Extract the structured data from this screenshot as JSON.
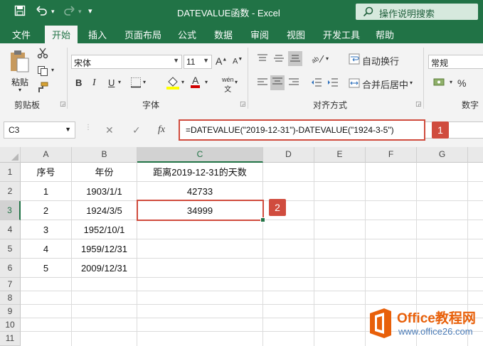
{
  "window": {
    "title": "DATEVALUE函数  -  Excel",
    "search_placeholder": "操作说明搜索"
  },
  "quick_access": {
    "save_icon": "save-icon",
    "undo_icon": "undo-icon",
    "redo_icon": "redo-icon",
    "more_icon": "▾"
  },
  "tabs": [
    "文件",
    "开始",
    "插入",
    "页面布局",
    "公式",
    "数据",
    "审阅",
    "视图",
    "开发工具",
    "帮助"
  ],
  "active_tab": "开始",
  "ribbon": {
    "clipboard": {
      "paste": "粘贴",
      "label": "剪贴板"
    },
    "font": {
      "name": "宋体",
      "size": "11",
      "bold": "B",
      "italic": "I",
      "underline": "U",
      "grow": "A",
      "shrink": "A",
      "font_color": "A",
      "phonetic": "wén",
      "label": "字体"
    },
    "alignment": {
      "wrap": "自动换行",
      "merge": "合并后居中",
      "label": "对齐方式"
    },
    "number": {
      "format": "常规",
      "percent": "%",
      "label": "数字"
    }
  },
  "formula_bar": {
    "name_box": "C3",
    "cancel": "✕",
    "enter": "✓",
    "fx": "fx",
    "formula": "=DATEVALUE(\"2019-12-31\")-DATEVALUE(\"1924-3-5\")"
  },
  "callouts": {
    "c1": "1",
    "c2": "2"
  },
  "columns": [
    "A",
    "B",
    "C",
    "D",
    "E",
    "F",
    "G"
  ],
  "rows": [
    "1",
    "2",
    "3",
    "4",
    "5",
    "6",
    "7",
    "8",
    "9",
    "10",
    "11"
  ],
  "cells": {
    "r1": {
      "a": "序号",
      "b": "年份",
      "c": "距离2019-12-31的天数"
    },
    "r2": {
      "a": "1",
      "b": "1903/1/1",
      "c": "42733"
    },
    "r3": {
      "a": "2",
      "b": "1924/3/5",
      "c": "34999"
    },
    "r4": {
      "a": "3",
      "b": "1952/10/1"
    },
    "r5": {
      "a": "4",
      "b": "1959/12/31"
    },
    "r6": {
      "a": "5",
      "b": "2009/12/31"
    }
  },
  "selected_cell": "C3",
  "watermark": {
    "brand": "Office教程网",
    "url": "www.office26.com"
  },
  "colors": {
    "excel_green": "#217346",
    "callout_red": "#d04c3e",
    "watermark_orange": "#e8600a"
  }
}
